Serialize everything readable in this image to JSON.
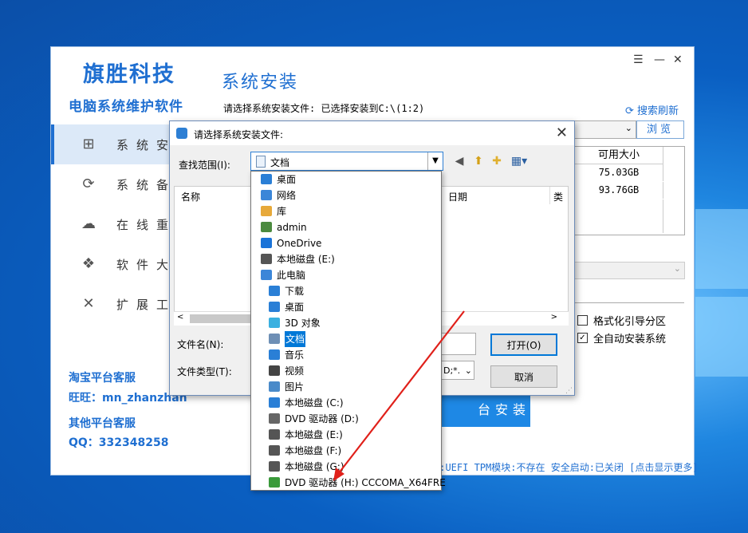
{
  "app": {
    "brand_title": "旗胜科技",
    "brand_subtitle": "电脑系统维护软件",
    "section_title": "系统安装",
    "window_controls": [
      "☰",
      "—",
      "✕"
    ],
    "nav": [
      {
        "label": "系统安",
        "icon": "windows-icon",
        "glyph": "⊞",
        "active": true
      },
      {
        "label": "系统备",
        "icon": "backup-icon",
        "glyph": "⟳",
        "active": false
      },
      {
        "label": "在线重",
        "icon": "cloud-icon",
        "glyph": "☁",
        "active": false
      },
      {
        "label": "软件大",
        "icon": "dropbox-icon",
        "glyph": "❖",
        "active": false
      },
      {
        "label": "扩展工",
        "icon": "tools-icon",
        "glyph": "✕",
        "active": false
      }
    ],
    "service": {
      "taobao_label": "淘宝平台客服",
      "wangwang": "旺旺：mn_zhanzhan",
      "other_label": "其他平台客服",
      "qq": "QQ：332348258"
    },
    "select_path_text": "请选择系统安装文件: 已选择安装到C:\\(1:2)",
    "refresh_label": "搜索刷新",
    "browse_label": "浏览",
    "partition_table": {
      "header": "可用大小",
      "rows": [
        "75.03GB",
        "93.76GB"
      ]
    },
    "options": [
      {
        "label": "格式化引导分区",
        "checked": false
      },
      {
        "label": "全自动安装系统",
        "checked": true
      }
    ],
    "install_button": "台安装",
    "status_text": "t:UEFI TPM模块:不存在 安全启动:已关闭 [点击显示更多]"
  },
  "dialog": {
    "title": "请选择系统安装文件:",
    "look_in_label": "查找范围(I):",
    "look_in_value": "文档",
    "columns": [
      "名称",
      "日期",
      "类"
    ],
    "file_name_label": "文件名(N):",
    "file_type_label": "文件类型(T):",
    "file_type_value": "D;*.",
    "open_button": "打开(O)",
    "cancel_button": "取消"
  },
  "dropdown": [
    {
      "label": "桌面",
      "icon": "desktop-icon",
      "indent": 0,
      "color": "#2a7fd6"
    },
    {
      "label": "网络",
      "icon": "network-icon",
      "indent": 0,
      "color": "#3b86d8"
    },
    {
      "label": "库",
      "icon": "library-icon",
      "indent": 0,
      "color": "#e7a93a"
    },
    {
      "label": "admin",
      "icon": "user-icon",
      "indent": 0,
      "color": "#4b8a3f"
    },
    {
      "label": "OneDrive",
      "icon": "onedrive-icon",
      "indent": 0,
      "color": "#1a73d8"
    },
    {
      "label": "本地磁盘 (E:)",
      "icon": "drive-icon",
      "indent": 0,
      "color": "#555555"
    },
    {
      "label": "此电脑",
      "icon": "computer-icon",
      "indent": 0,
      "color": "#3b86d8"
    },
    {
      "label": "下载",
      "icon": "download-icon",
      "indent": 1,
      "color": "#2a7fd6"
    },
    {
      "label": "桌面",
      "icon": "desktop-icon",
      "indent": 1,
      "color": "#2a7fd6"
    },
    {
      "label": "3D 对象",
      "icon": "3d-objects-icon",
      "indent": 1,
      "color": "#3ab0e0"
    },
    {
      "label": "文档",
      "icon": "document-icon",
      "indent": 1,
      "color": "#6e8fb5",
      "selected": true
    },
    {
      "label": "音乐",
      "icon": "music-icon",
      "indent": 1,
      "color": "#2a7fd6"
    },
    {
      "label": "视频",
      "icon": "video-icon",
      "indent": 1,
      "color": "#444444"
    },
    {
      "label": "图片",
      "icon": "pictures-icon",
      "indent": 1,
      "color": "#4a8ac9"
    },
    {
      "label": "本地磁盘 (C:)",
      "icon": "windows-drive-icon",
      "indent": 1,
      "color": "#2a7fd6"
    },
    {
      "label": "DVD 驱动器 (D:)",
      "icon": "dvd-icon",
      "indent": 1,
      "color": "#666666"
    },
    {
      "label": "本地磁盘 (E:)",
      "icon": "drive-icon",
      "indent": 1,
      "color": "#555555"
    },
    {
      "label": "本地磁盘 (F:)",
      "icon": "drive-icon",
      "indent": 1,
      "color": "#555555"
    },
    {
      "label": "本地磁盘 (G:)",
      "icon": "drive-icon",
      "indent": 1,
      "color": "#555555"
    },
    {
      "label": "DVD 驱动器 (H:) CCCOMA_X64FRE",
      "icon": "dvd-mounted-icon",
      "indent": 1,
      "color": "#3a9a3a"
    }
  ],
  "colors": {
    "accent": "#1f6fd1",
    "annotation_arrow": "#e0201a",
    "selection": "#0078d7"
  }
}
